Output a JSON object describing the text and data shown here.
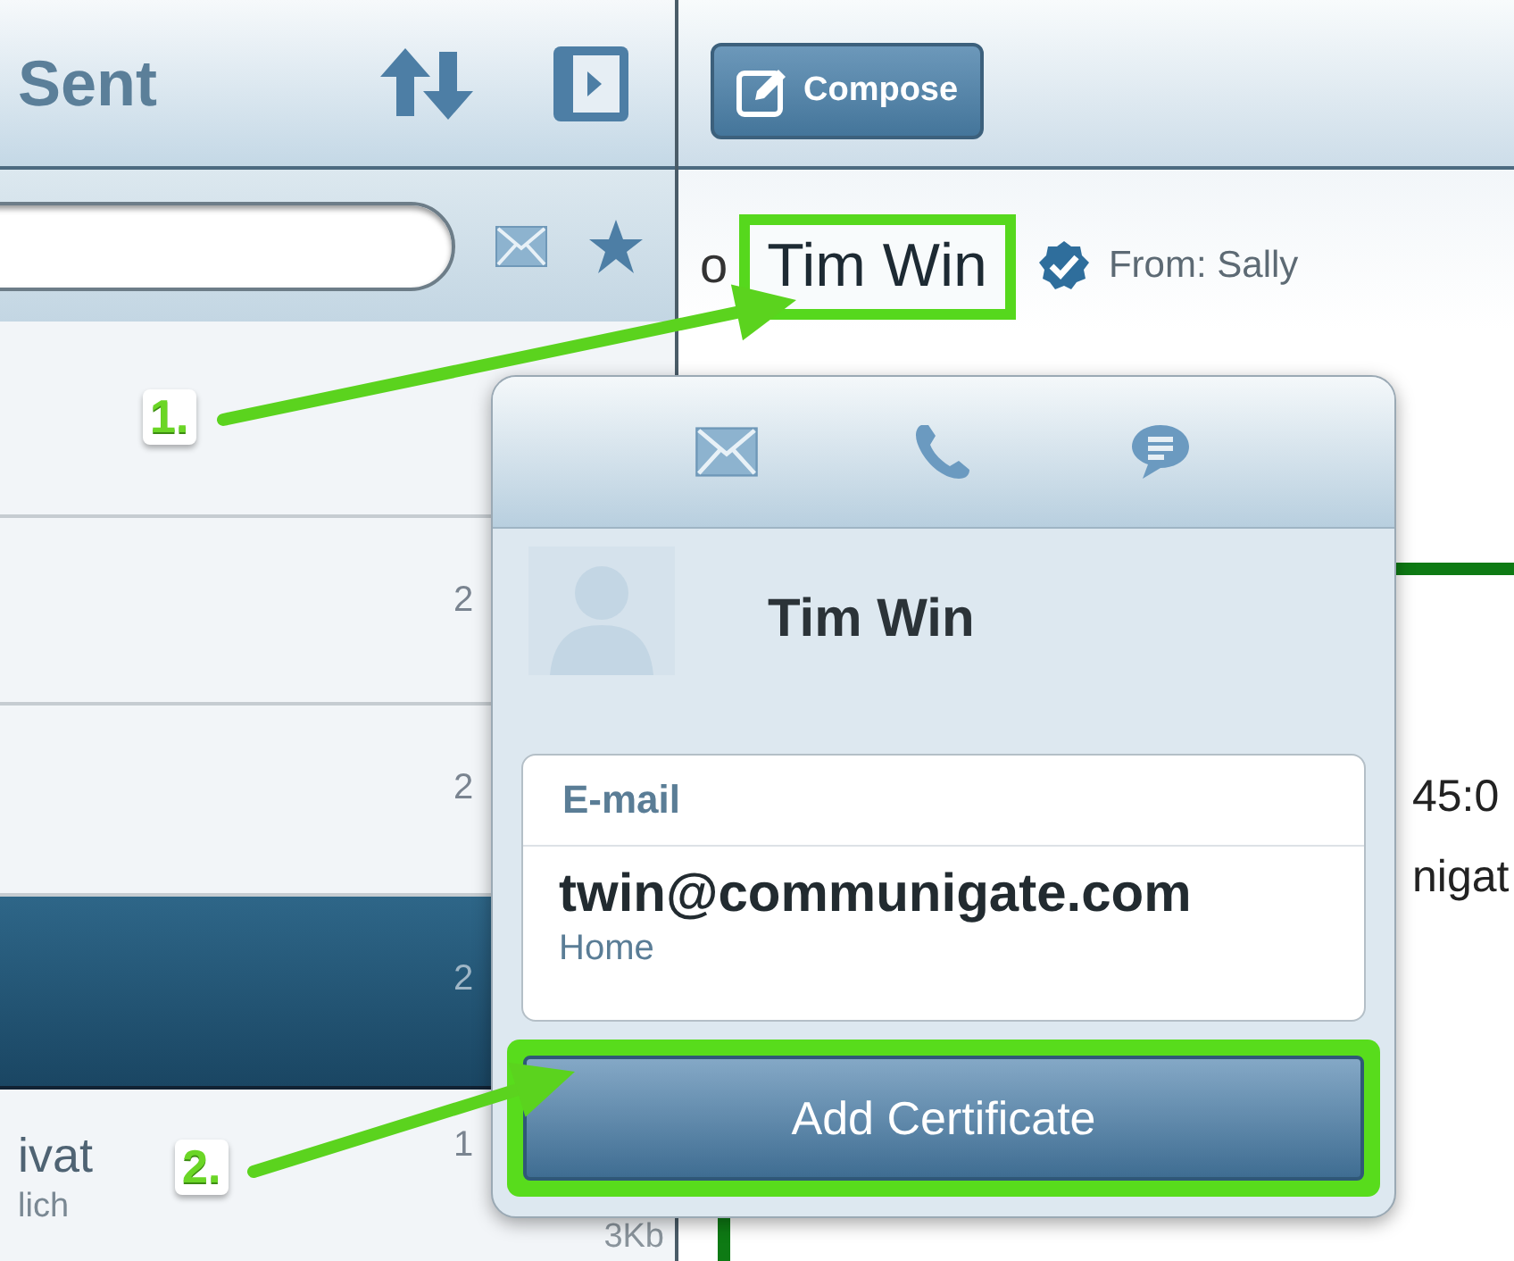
{
  "list_pane": {
    "title": "Sent",
    "rows": [
      {
        "selected": false
      },
      {
        "date": "2",
        "selected": false
      },
      {
        "date": "2",
        "selected": false
      },
      {
        "date": "2",
        "selected": true
      },
      {
        "title": "ivat",
        "subtitle": "lich",
        "date": "1",
        "size": "3Kb",
        "selected": false
      }
    ]
  },
  "message_pane": {
    "compose_button": "Compose",
    "to_fragment": "o",
    "recipient": "Tim Win",
    "from": "From: Sally",
    "body_fragments": [
      "45:0",
      "nigat"
    ]
  },
  "contact_popover": {
    "name": "Tim Win",
    "email_label": "E-mail",
    "email": "twin@communigate.com",
    "email_type": "Home",
    "button": "Add Certificate"
  },
  "annotations": [
    {
      "label": "1."
    },
    {
      "label": "2."
    }
  ]
}
